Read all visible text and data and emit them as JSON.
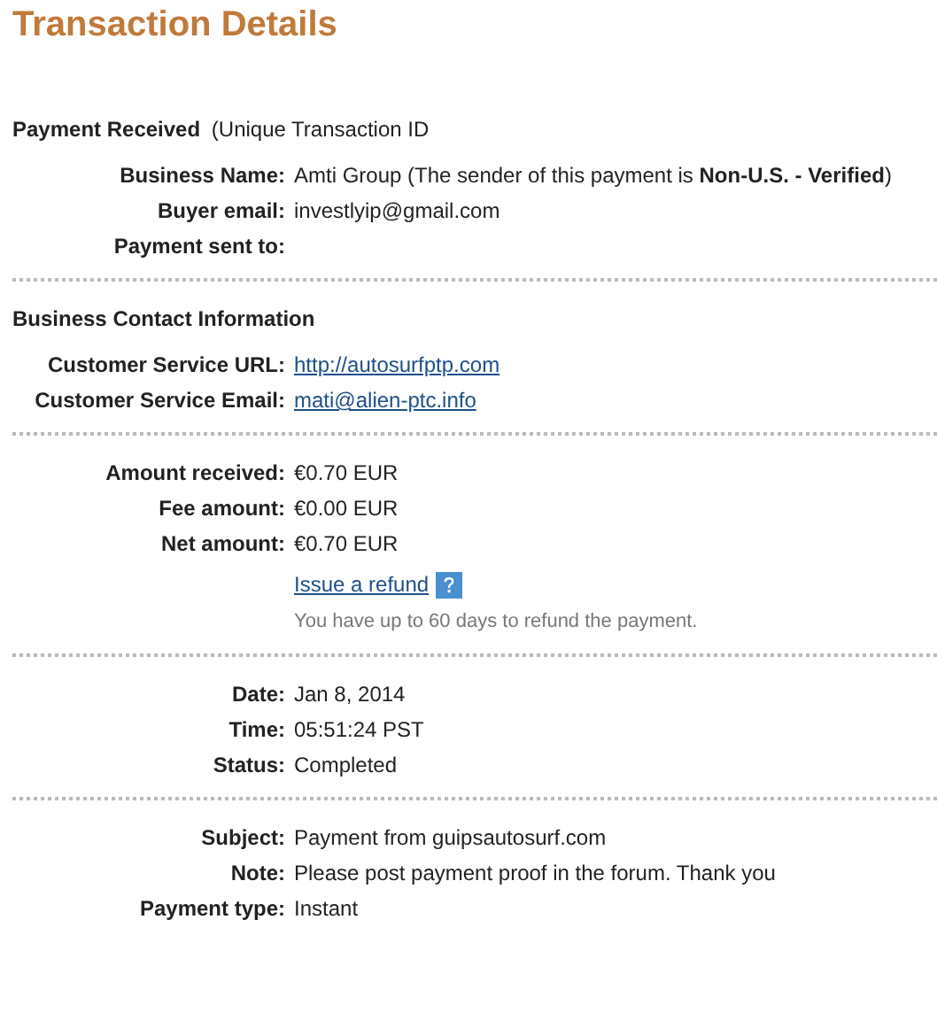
{
  "title": "Transaction Details",
  "sections": [
    {
      "heading": "Payment Received",
      "heading_note": "(Unique Transaction ID",
      "rows": [
        {
          "label": "Business Name:",
          "value": "Amti Group (The sender of this payment is **Non-U.S. - Verified**)",
          "kind": "text"
        },
        {
          "label": "Buyer email:",
          "value": "investlyip@gmail.com",
          "kind": "text"
        },
        {
          "label": "Payment sent to:",
          "kind": "text"
        }
      ]
    },
    {
      "heading": "Business Contact Information",
      "rows": [
        {
          "label": "Customer Service URL:",
          "value": "http://autosurfptp.com",
          "kind": "link"
        },
        {
          "label": "Customer Service Email:",
          "value": "mati@alien-ptc.info",
          "kind": "link"
        }
      ]
    },
    {
      "rows": [
        {
          "label": "Amount received:",
          "value": "€0.70 EUR",
          "kind": "text"
        },
        {
          "label": "Fee amount:",
          "value": "€0.00 EUR",
          "kind": "text"
        },
        {
          "label": "Net amount:",
          "value": "€0.70 EUR",
          "kind": "text"
        },
        {
          "value": "Issue a refund",
          "kind": "refund",
          "note": "You have up to 60 days to refund the payment."
        }
      ]
    },
    {
      "rows": [
        {
          "label": "Date:",
          "value": "Jan 8, 2014",
          "kind": "text"
        },
        {
          "label": "Time:",
          "value": "05:51:24 PST",
          "kind": "text"
        },
        {
          "label": "Status:",
          "value": "Completed",
          "kind": "text"
        }
      ]
    },
    {
      "rows": [
        {
          "label": "Subject:",
          "value": "Payment from guipsautosurf.com",
          "kind": "text"
        },
        {
          "label": "Note:",
          "value": "Please post payment proof in the forum. Thank you",
          "kind": "text"
        },
        {
          "label": "Payment type:",
          "value": "Instant",
          "kind": "text"
        }
      ]
    }
  ]
}
